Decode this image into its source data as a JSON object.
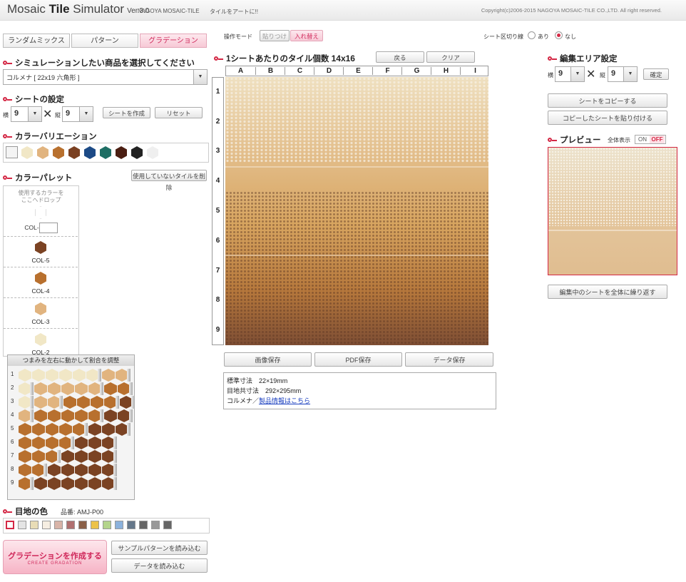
{
  "header": {
    "logo_a": "Mosaic ",
    "logo_b": "Tile",
    "logo_c": " Simulator",
    "version": "Ver.3.0",
    "company": "NAGOYA MOSAIC-TILE",
    "tagline": "タイルをアートに!!",
    "copyright": "Copyright(c)2006-2015 NAGOYA MOSAIC-TILE CO.,LTD. All right reserved."
  },
  "tabs": [
    "ランダムミックス",
    "パターン",
    "グラデーション"
  ],
  "active_tab": "グラデーション",
  "product": {
    "title": "シミュレーションしたい商品を選択してください",
    "selected": "コルメナ [ 22x19 六角形 ]"
  },
  "sheet_settings": {
    "title": "シートの設定",
    "h_label": "横",
    "h_value": "9",
    "v_label": "縦",
    "v_value": "9",
    "times": "✕",
    "create_btn": "シートを作成",
    "reset_btn": "リセット"
  },
  "color_variation": {
    "title": "カラーバリエーション",
    "colors": [
      "#f4f4f4",
      "#f1e7c6",
      "#e1b47f",
      "#b8702e",
      "#7a4021",
      "#1c4a86",
      "#1e6e64",
      "#4a1e12",
      "#222222",
      "#efefef"
    ]
  },
  "palette": {
    "title": "カラーパレット",
    "delete_unused_btn": "使用していないタイルを削除",
    "drop_text_1": "使用するカラーを",
    "drop_text_2": "ここへドロップ",
    "empty_label": "COL-",
    "items": [
      {
        "label": "COL-5",
        "color": "#7b4323"
      },
      {
        "label": "COL-4",
        "color": "#b8702e"
      },
      {
        "label": "COL-3",
        "color": "#e1b47f"
      },
      {
        "label": "COL-2",
        "color": "#f1e7c6"
      }
    ]
  },
  "ratio": {
    "title": "つまみを左右に動かして割合を調整",
    "rows": [
      "1",
      "2",
      "3",
      "4",
      "5",
      "6",
      "7",
      "8",
      "9"
    ],
    "proportions": [
      [
        6,
        2,
        0,
        0
      ],
      [
        1,
        5,
        2,
        0
      ],
      [
        1,
        2,
        4,
        1
      ],
      [
        0,
        1,
        5,
        2
      ],
      [
        0,
        0,
        5,
        3
      ],
      [
        0,
        0,
        4,
        3
      ],
      [
        0,
        0,
        3,
        4
      ],
      [
        0,
        0,
        2,
        5
      ],
      [
        0,
        0,
        1,
        6
      ]
    ]
  },
  "joint": {
    "title": "目地の色",
    "code": "品番: AMJ-P00",
    "colors": [
      "#ffffff",
      "#e4e4e4",
      "#e8dcb6",
      "#f6eee2",
      "#d8b4a8",
      "#b07070",
      "#8a6048",
      "#ecc24a",
      "#b4d48c",
      "#8cb2dc",
      "#66788a",
      "#666666",
      "#999999",
      "#666666"
    ]
  },
  "actions": {
    "create_gradation": "グラデーションを作成する",
    "create_gradation_en": "CREATE GRADATION",
    "load_sample": "サンプルパターンを読み込む",
    "load_data": "データを読み込む"
  },
  "mode": {
    "label": "操作モード",
    "paste": "貼りつけ",
    "replace": "入れ替え",
    "sheet_divider_label": "シート区切り線",
    "on": "あり",
    "off": "なし"
  },
  "grid": {
    "title": "1シートあたりのタイル個数",
    "count": "14x16",
    "back_btn": "戻る",
    "clear_btn": "クリア",
    "cols": [
      "A",
      "B",
      "C",
      "D",
      "E",
      "F",
      "G",
      "H",
      "I"
    ],
    "rows": [
      "1",
      "2",
      "3",
      "4",
      "5",
      "6",
      "7",
      "8",
      "9"
    ]
  },
  "save": {
    "image": "画像保存",
    "pdf": "PDF保存",
    "data": "データ保存"
  },
  "info": {
    "std_size": "標準寸法　22×19mm",
    "joint_size": "目地共寸法　292×295mm",
    "product_prefix": "コルメナ／",
    "product_link": "製品情報はこちら"
  },
  "edit_area": {
    "title": "編集エリア設定",
    "h_label": "横",
    "h_value": "9",
    "v_label": "縦",
    "v_value": "9",
    "times": "✕",
    "confirm_btn": "確定",
    "copy_btn": "シートをコピーする",
    "paste_btn": "コピーしたシートを貼り付ける",
    "repeat_btn": "編集中のシートを全体に繰り返す"
  },
  "preview": {
    "title": "プレビュー",
    "full_label": "全体表示",
    "on": "ON",
    "off": "OFF"
  }
}
